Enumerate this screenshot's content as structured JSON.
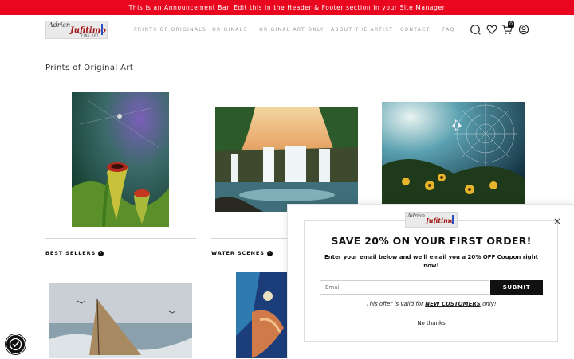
{
  "announcement": "This is an Announcement Bar. Edit this in the Header & Footer section in your Site Manager",
  "logo": {
    "line1": "Adrian",
    "line2": "Jufitimo",
    "line3": "FINE ART"
  },
  "nav": [
    "PRINTS OF ORIGINALS",
    "ORIGINALS",
    "ORIGINAL ART ONLY",
    "ABOUT THE ARTIST",
    "CONTACT",
    "FAQ"
  ],
  "icons": {
    "search": "search-icon",
    "wishlist": "heart-icon",
    "cart": "cart-icon",
    "account": "account-icon"
  },
  "cart_count": "0",
  "page_title": "Prints of Original Art",
  "categories": [
    "BEST SELLERS",
    "WATER SCENES"
  ],
  "popup": {
    "close": "×",
    "headline": "SAVE 20% ON YOUR FIRST ORDER!",
    "subtext": "Enter your email below and we'll email you a 20% OFF Coupon right now!",
    "email_placeholder": "Email",
    "submit_label": "SUBMIT",
    "offer_prefix": "This offer is valid for",
    "offer_emph": "NEW CUSTOMERS",
    "offer_suffix": "only!",
    "no_thanks": "No thanks"
  },
  "colors": {
    "announcement_bg": "#e8071f",
    "button_bg": "#111111"
  }
}
